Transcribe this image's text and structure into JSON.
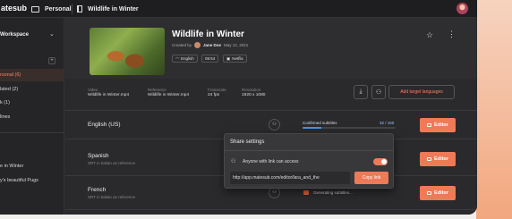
{
  "topbar": {
    "logo": "atesub",
    "breadcrumb_folder": "Personal",
    "breadcrumb_video": "Wildlife in Winter"
  },
  "sidebar": {
    "title": "Workspace",
    "items": [
      {
        "label": "rsonal (6)",
        "active": true
      },
      {
        "label": "lated (2)",
        "active": false
      },
      {
        "label": "k (1)",
        "active": false
      },
      {
        "label": "lines",
        "active": false
      },
      {
        "label": "e in Winter",
        "active": false
      },
      {
        "label": "y's beautiful Pugs",
        "active": false
      }
    ]
  },
  "video": {
    "title": "Wildlife in Winter",
    "created_prefix": "Created by",
    "author": "Jane Doe",
    "date": "May 12, 2021",
    "tags": [
      "English",
      "08:54",
      "Netflix"
    ]
  },
  "meta": [
    {
      "label": "Video",
      "value": "Wildlife in Winter.mp4"
    },
    {
      "label": "Reference",
      "value": "Wildlife in Winter.mp4"
    },
    {
      "label": "Framerate",
      "value": "24 fps"
    },
    {
      "label": "Resolution",
      "value": "1920 x 1080"
    }
  ],
  "actions": {
    "add_target": "Add target languages"
  },
  "languages": [
    {
      "name": "English (US)",
      "sub": "",
      "status": "Confirmed subtitles",
      "count": "32 / 160",
      "progress": 0.2,
      "button": "Editor"
    },
    {
      "name": "Spanish",
      "sub": "SRT in Italian as reference",
      "status": "",
      "count": "",
      "button": "Editor"
    },
    {
      "name": "French",
      "sub": "SRT in Italian as reference",
      "status": "Generating subtitles...",
      "count": "",
      "button": "Editor"
    }
  ],
  "share": {
    "title": "Share settings",
    "access_label": "Anyone with link can access",
    "access_enabled": true,
    "link": "http://app.matesub.com/editor/lara_and_the",
    "copy_label": "Copy link"
  },
  "colors": {
    "accent": "#ee7a57",
    "progress": "#4a90e2",
    "background": "#2a2a2c"
  }
}
